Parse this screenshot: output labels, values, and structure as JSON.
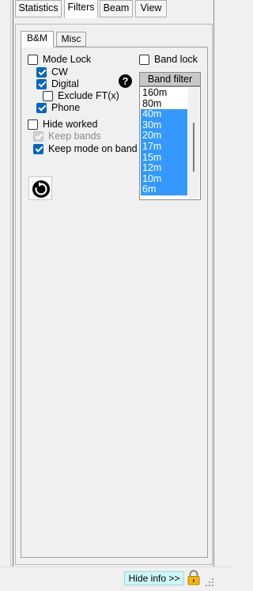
{
  "tabs": [
    {
      "label": "Statistics",
      "active": false
    },
    {
      "label": "Filters",
      "active": true
    },
    {
      "label": "Beam",
      "active": false
    },
    {
      "label": "View",
      "active": false
    }
  ],
  "subtabs": [
    {
      "label": "B&M",
      "active": true
    },
    {
      "label": "Misc",
      "active": false
    }
  ],
  "filters": {
    "mode_lock": {
      "label": "Mode Lock",
      "checked": false
    },
    "cw": {
      "label": "CW",
      "checked": true
    },
    "digital": {
      "label": "Digital",
      "checked": true
    },
    "exclude_ft": {
      "label": "Exclude FT(x)",
      "checked": false
    },
    "phone": {
      "label": "Phone",
      "checked": true
    },
    "hide_worked": {
      "label": "Hide worked",
      "checked": false
    },
    "keep_bands": {
      "label": "Keep bands",
      "checked": true,
      "disabled": true
    },
    "keep_mode_on_band": {
      "label": "Keep mode on band",
      "checked": true
    },
    "band_lock": {
      "label": "Band lock",
      "checked": false
    }
  },
  "help_icon": {
    "symbol": "?"
  },
  "band_filter": {
    "header": "Band filter",
    "items": [
      {
        "label": "160m",
        "selected": false
      },
      {
        "label": "80m",
        "selected": false
      },
      {
        "label": "40m",
        "selected": true
      },
      {
        "label": "30m",
        "selected": true
      },
      {
        "label": "20m",
        "selected": true
      },
      {
        "label": "17m",
        "selected": true
      },
      {
        "label": "15m",
        "selected": true
      },
      {
        "label": "12m",
        "selected": true
      },
      {
        "label": "10m",
        "selected": true
      },
      {
        "label": "6m",
        "selected": true
      }
    ]
  },
  "icons": {
    "refresh": "refresh-icon",
    "lock": "padlock-icon",
    "grip": "resize-grip-icon"
  },
  "footer": {
    "hide_info_label": "Hide info >>"
  },
  "colors": {
    "accent": "#0067c0",
    "selection": "#3399ff",
    "hide_info_bg": "#cdf7f6",
    "lock": "#f2b705"
  }
}
